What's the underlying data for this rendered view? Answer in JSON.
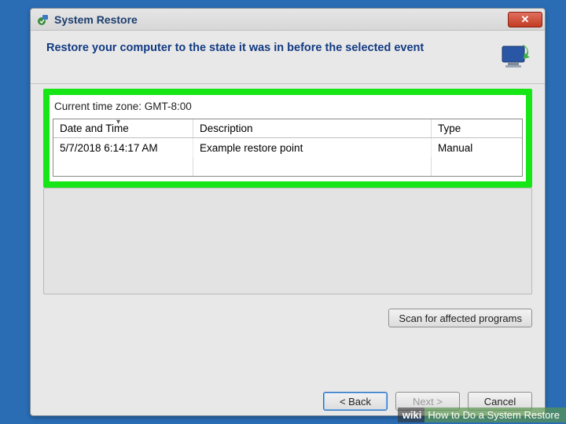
{
  "title": "System Restore",
  "heading": "Restore your computer to the state it was in before the selected event",
  "timezone_label": "Current time zone: GMT-8:00",
  "columns": {
    "date": "Date and Time",
    "desc": "Description",
    "type": "Type"
  },
  "rows": [
    {
      "date": "5/7/2018 6:14:17 AM",
      "desc": "Example restore point",
      "type": "Manual"
    }
  ],
  "buttons": {
    "scan": "Scan for affected programs",
    "back": "< Back",
    "next": "Next >",
    "cancel": "Cancel"
  },
  "watermark": {
    "brand": "wiki",
    "rest": "How to Do a System Restore"
  }
}
